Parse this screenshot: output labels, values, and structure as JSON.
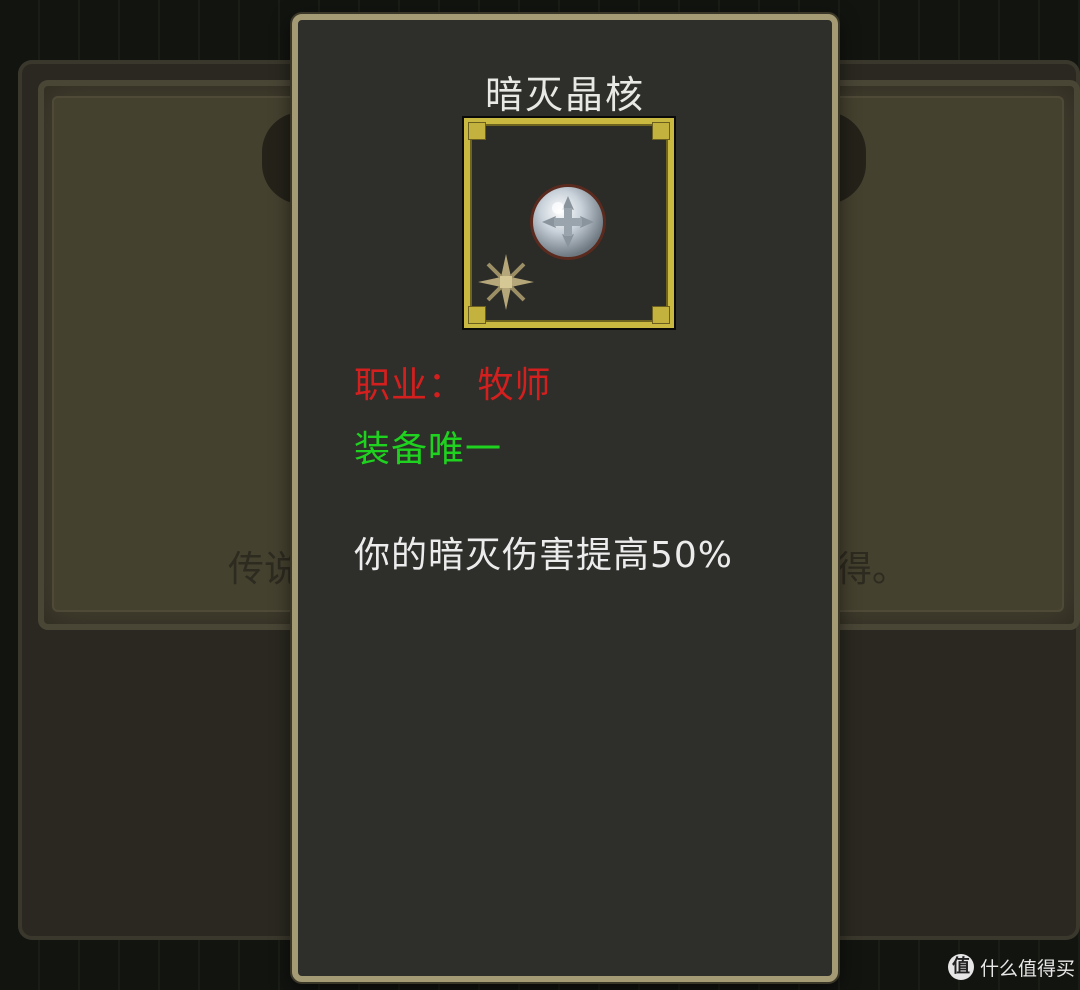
{
  "background": {
    "text_left": "传说",
    "text_right": "得。"
  },
  "tooltip": {
    "title": "暗灭晶核",
    "item_icon": "crystal-orb-icon",
    "rarity_icon": "sparkle-star-icon",
    "class_line": "职业：  牧师",
    "class_color": "#d41f1f",
    "unique_line": "装备唯一",
    "unique_color": "#1fd21f",
    "description": "你的暗灭伤害提高50%",
    "description_color": "#ececec",
    "frame_color": "#c9b941"
  },
  "watermark": {
    "logo": "值",
    "text": "什么值得买"
  }
}
